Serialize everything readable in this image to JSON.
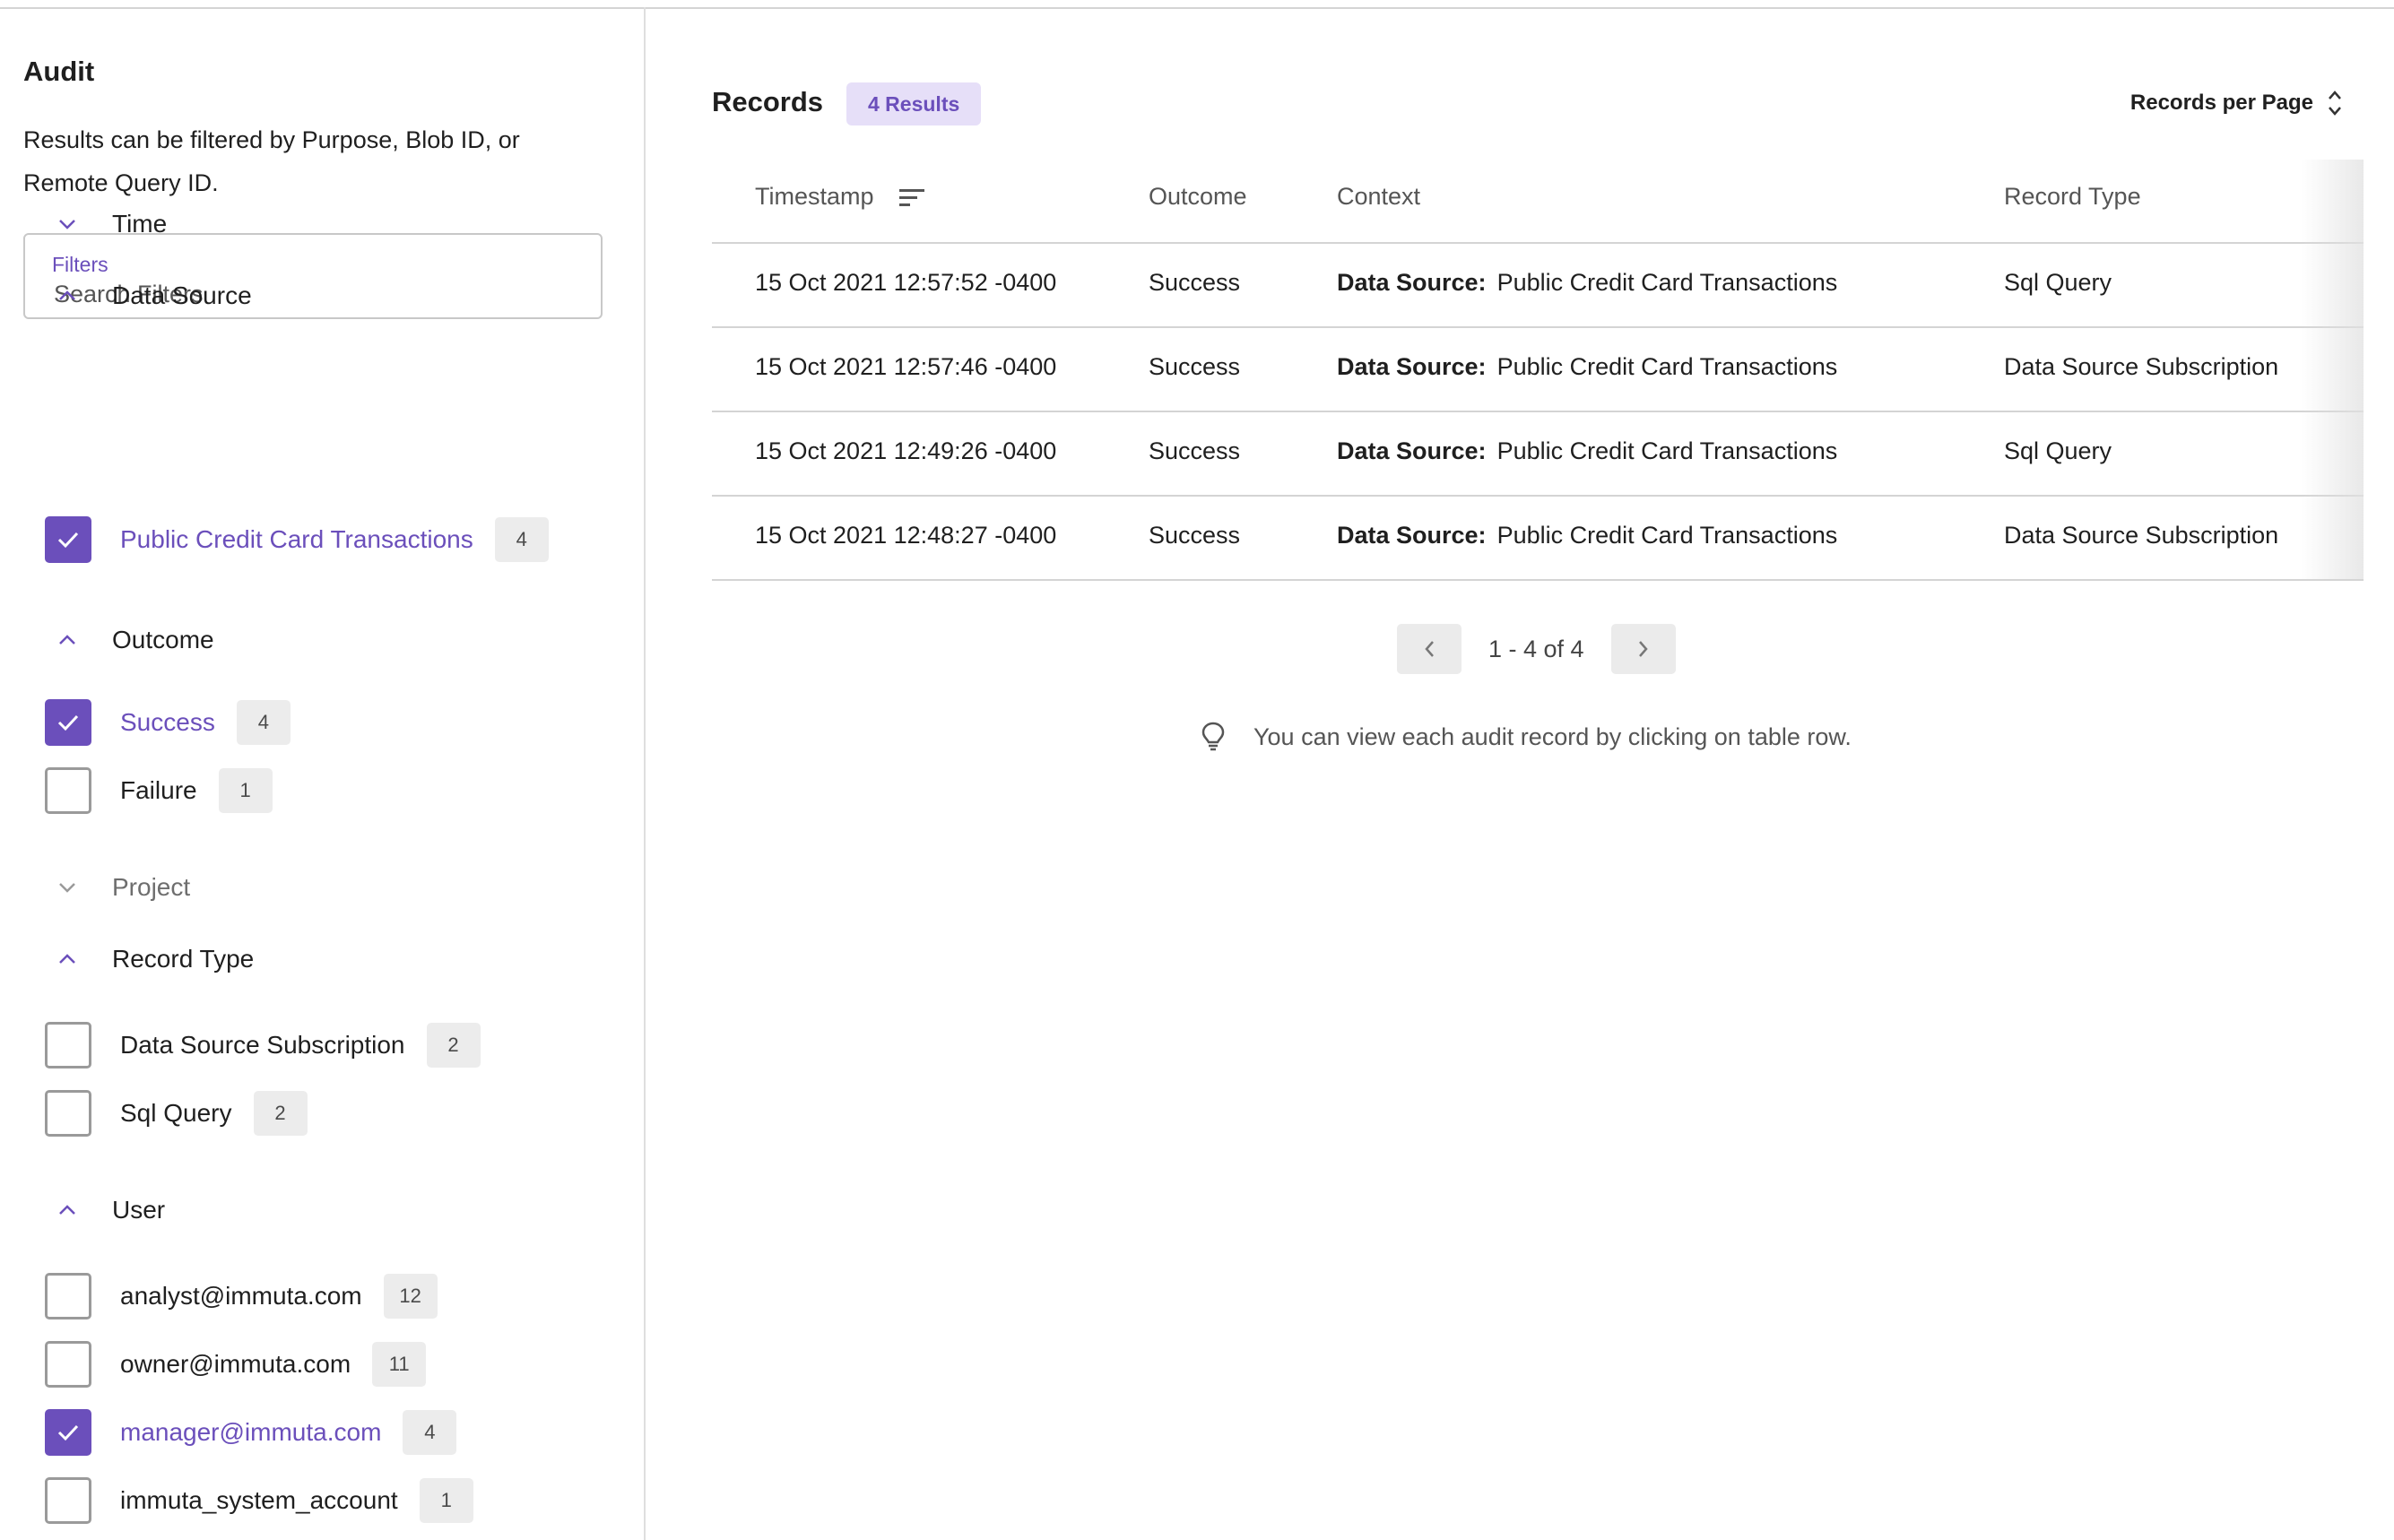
{
  "sidebar": {
    "title": "Audit",
    "description": "Results can be filtered by Purpose, Blob ID, or Remote Query ID.",
    "filter": {
      "label": "Filters",
      "placeholder": "Search Filters",
      "value": ""
    },
    "sections": {
      "time": {
        "label": "Time",
        "expanded": false
      },
      "data_source": {
        "label": "Data Source",
        "expanded": true,
        "items": [
          {
            "label": "Public Credit Card Transactions",
            "count": "4",
            "checked": true
          }
        ]
      },
      "outcome": {
        "label": "Outcome",
        "expanded": true,
        "items": [
          {
            "label": "Success",
            "count": "4",
            "checked": true
          },
          {
            "label": "Failure",
            "count": "1",
            "checked": false
          }
        ]
      },
      "project": {
        "label": "Project",
        "expanded": false
      },
      "record_type": {
        "label": "Record Type",
        "expanded": true,
        "items": [
          {
            "label": "Data Source Subscription",
            "count": "2",
            "checked": false
          },
          {
            "label": "Sql Query",
            "count": "2",
            "checked": false
          }
        ]
      },
      "user": {
        "label": "User",
        "expanded": true,
        "items": [
          {
            "label": "analyst@immuta.com",
            "count": "12",
            "checked": false
          },
          {
            "label": "owner@immuta.com",
            "count": "11",
            "checked": false
          },
          {
            "label": "manager@immuta.com",
            "count": "4",
            "checked": true
          },
          {
            "label": "immuta_system_account",
            "count": "1",
            "checked": false
          }
        ]
      }
    }
  },
  "main": {
    "title": "Records",
    "results_badge": "4 Results",
    "records_per_page": "Records per Page",
    "table": {
      "columns": {
        "timestamp": "Timestamp",
        "outcome": "Outcome",
        "context": "Context",
        "record_type": "Record Type"
      },
      "rows": [
        {
          "timestamp": "15 Oct 2021 12:57:52 -0400",
          "outcome": "Success",
          "context_key": "Data Source:",
          "context_value": "Public Credit Card Transactions",
          "record_type": "Sql Query"
        },
        {
          "timestamp": "15 Oct 2021 12:57:46 -0400",
          "outcome": "Success",
          "context_key": "Data Source:",
          "context_value": "Public Credit Card Transactions",
          "record_type": "Data Source Subscription"
        },
        {
          "timestamp": "15 Oct 2021 12:49:26 -0400",
          "outcome": "Success",
          "context_key": "Data Source:",
          "context_value": "Public Credit Card Transactions",
          "record_type": "Sql Query"
        },
        {
          "timestamp": "15 Oct 2021 12:48:27 -0400",
          "outcome": "Success",
          "context_key": "Data Source:",
          "context_value": "Public Credit Card Transactions",
          "record_type": "Data Source Subscription"
        }
      ]
    },
    "pagination": {
      "range": "1 - 4 of 4"
    },
    "hint": "You can view each audit record by clicking on table row."
  },
  "icons": {
    "chevron": "chevron-icon",
    "checkmark": "checkmark-icon",
    "sort": "sort-icon",
    "unfold": "unfold-icon",
    "lightbulb": "lightbulb-icon"
  },
  "colors": {
    "accent": "#6b4fbb",
    "badge_bg": "#e6dff8",
    "count_bg": "#ececec",
    "border": "#d4d4d4"
  }
}
